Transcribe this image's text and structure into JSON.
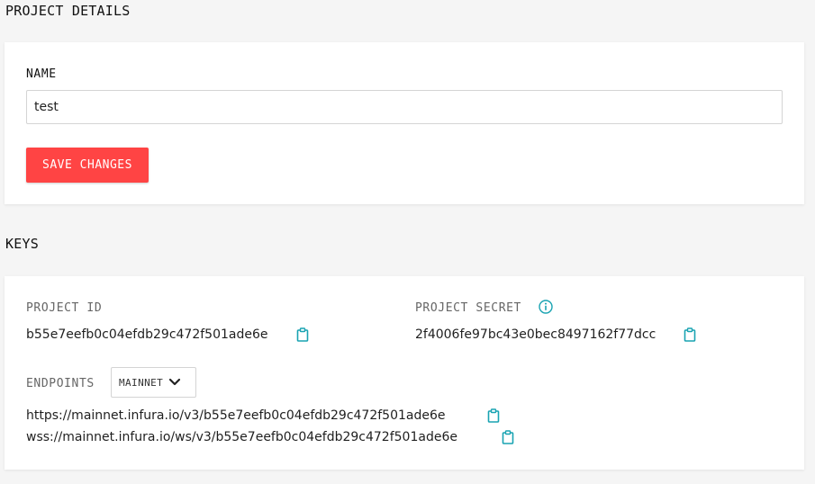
{
  "project_details": {
    "title": "PROJECT DETAILS",
    "name_label": "NAME",
    "name_value": "test",
    "save_label": "SAVE CHANGES"
  },
  "keys": {
    "title": "KEYS",
    "project_id_label": "PROJECT ID",
    "project_id_value": "b55e7eefb0c04efdb29c472f501ade6e",
    "project_secret_label": "PROJECT SECRET",
    "project_secret_value": "2f4006fe97bc43e0bec8497162f77dcc",
    "endpoints_label": "ENDPOINTS",
    "network_selected": "MAINNET",
    "https_endpoint": "https://mainnet.infura.io/v3/b55e7eefb0c04efdb29c472f501ade6e",
    "wss_endpoint": "wss://mainnet.infura.io/ws/v3/b55e7eefb0c04efdb29c472f501ade6e"
  },
  "icons": {
    "copy": "clipboard-icon",
    "info": "info-icon",
    "dropdown": "chevron-down-icon"
  },
  "colors": {
    "accent": "#ff4444",
    "icon_teal": "#19a3b2",
    "background": "#f5f5f5",
    "card": "#ffffff"
  }
}
